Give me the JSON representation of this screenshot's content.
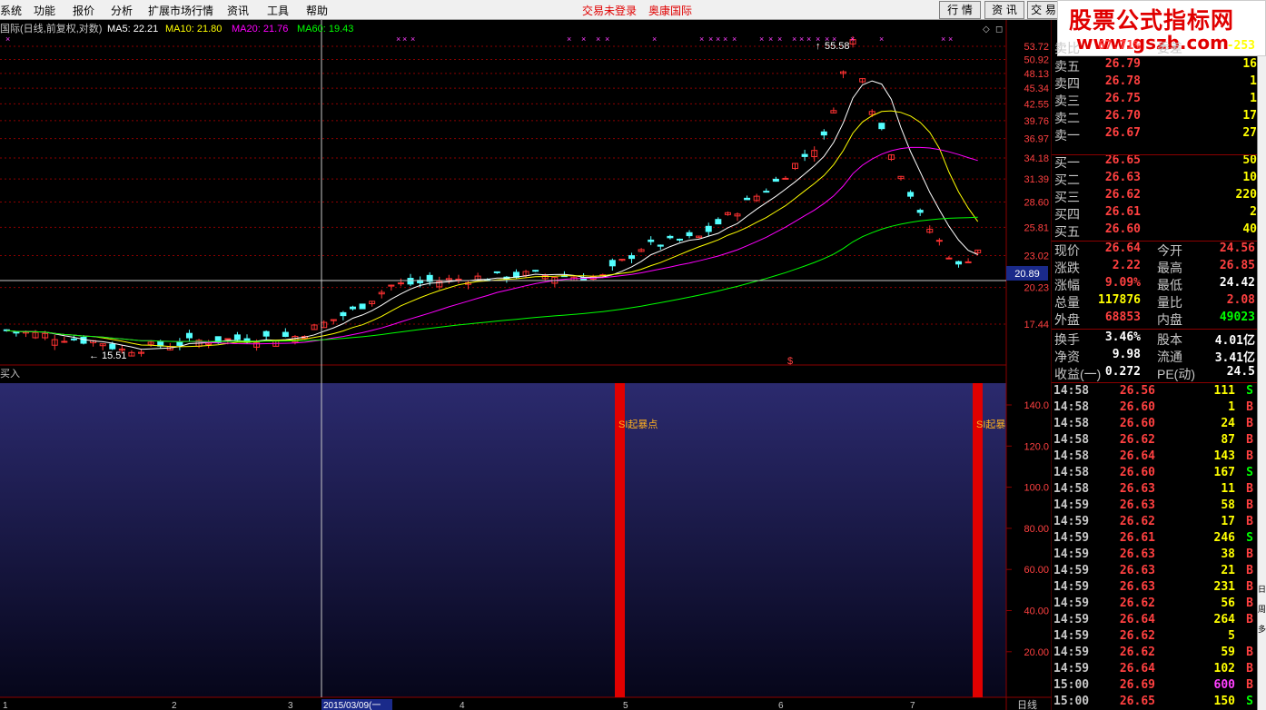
{
  "menu": {
    "items": [
      "系统",
      "功能",
      "报价",
      "分析",
      "扩展市场行情",
      "资讯",
      "工具",
      "帮助"
    ],
    "login_status": "交易未登录",
    "broker": "奥康国际",
    "btn_quote": "行 情",
    "btn_news": "资 讯",
    "btn_trade": "交 易"
  },
  "watermark": {
    "line1": "股票公式指标网",
    "line2": "www.gszb.com"
  },
  "colors": {
    "up": "#ff3232",
    "down": "#54ffff",
    "ma5": "#ffffff",
    "ma10": "#ffff00",
    "ma20": "#ff00ff",
    "ma60": "#00ff00",
    "grid": "#8b0000",
    "price": "#ff4040"
  },
  "chart": {
    "info": "国际(日线,前复权,对数)",
    "ma5": "MA5: 22.21",
    "ma10": "MA10: 21.80",
    "ma20": "MA20: 21.76",
    "ma60": "MA60: 19.43",
    "price_ticks": [
      "53.72",
      "50.92",
      "48.13",
      "45.34",
      "42.55",
      "39.76",
      "36.97",
      "34.18",
      "31.39",
      "28.60",
      "25.81",
      "23.02",
      "20.23",
      "17.44"
    ],
    "crosshair_value": "20.89",
    "high_label": "55.58",
    "low_label": "15.51",
    "dollar_mark": "$",
    "sub_title": "买入",
    "sub_ticks": [
      "140.0",
      "120.0",
      "100.0",
      "80.00",
      "60.00",
      "40.00",
      "20.00"
    ],
    "signal_labels": [
      "SI起暴点",
      "SI起暴"
    ],
    "date_labels": [
      "2015/03/09(一",
      "日线"
    ],
    "axis_numbers": [
      "1",
      "2",
      "3",
      "4",
      "5",
      "6",
      "7"
    ]
  },
  "quote": {
    "sell_title": "卖比",
    "sell_title_val": "67.71%",
    "sell_diff_title": "委差",
    "sell_diff_val": "-253",
    "asks": [
      {
        "label": "卖五",
        "price": "26.79",
        "vol": "16"
      },
      {
        "label": "卖四",
        "price": "26.78",
        "vol": "1"
      },
      {
        "label": "卖三",
        "price": "26.75",
        "vol": "1"
      },
      {
        "label": "卖二",
        "price": "26.70",
        "vol": "17"
      },
      {
        "label": "卖一",
        "price": "26.67",
        "vol": "27"
      }
    ],
    "bids": [
      {
        "label": "买一",
        "price": "26.65",
        "vol": "50"
      },
      {
        "label": "买二",
        "price": "26.63",
        "vol": "10"
      },
      {
        "label": "买三",
        "price": "26.62",
        "vol": "220"
      },
      {
        "label": "买四",
        "price": "26.61",
        "vol": "2"
      },
      {
        "label": "买五",
        "price": "26.60",
        "vol": "40"
      }
    ],
    "stats": [
      {
        "l1": "现价",
        "v1": "26.64",
        "l2": "今开",
        "v2": "24.56"
      },
      {
        "l1": "涨跌",
        "v1": "2.22",
        "l2": "最高",
        "v2": "26.85"
      },
      {
        "l1": "涨幅",
        "v1": "9.09%",
        "l2": "最低",
        "v2": "24.42"
      },
      {
        "l1": "总量",
        "v1": "117876",
        "l2": "量比",
        "v2": "2.08"
      },
      {
        "l1": "外盘",
        "v1": "68853",
        "l2": "内盘",
        "v2": "49023"
      },
      {
        "l1": "换手",
        "v1": "3.46%",
        "l2": "股本",
        "v2": "4.01亿"
      },
      {
        "l1": "净资",
        "v1": "9.98",
        "l2": "流通",
        "v2": "3.41亿"
      },
      {
        "l1": "收益(一)",
        "v1": "0.272",
        "l2": "PE(动)",
        "v2": "24.5"
      }
    ]
  },
  "ticks": [
    {
      "t": "14:58",
      "p": "26.56",
      "v": "111",
      "d": "S"
    },
    {
      "t": "14:58",
      "p": "26.60",
      "v": "1",
      "d": "B"
    },
    {
      "t": "14:58",
      "p": "26.60",
      "v": "24",
      "d": "B"
    },
    {
      "t": "14:58",
      "p": "26.62",
      "v": "87",
      "d": "B"
    },
    {
      "t": "14:58",
      "p": "26.64",
      "v": "143",
      "d": "B"
    },
    {
      "t": "14:58",
      "p": "26.60",
      "v": "167",
      "d": "S"
    },
    {
      "t": "14:58",
      "p": "26.63",
      "v": "11",
      "d": "B"
    },
    {
      "t": "14:59",
      "p": "26.63",
      "v": "58",
      "d": "B"
    },
    {
      "t": "14:59",
      "p": "26.62",
      "v": "17",
      "d": "B"
    },
    {
      "t": "14:59",
      "p": "26.61",
      "v": "246",
      "d": "S"
    },
    {
      "t": "14:59",
      "p": "26.63",
      "v": "38",
      "d": "B"
    },
    {
      "t": "14:59",
      "p": "26.63",
      "v": "21",
      "d": "B"
    },
    {
      "t": "14:59",
      "p": "26.63",
      "v": "231",
      "d": "B"
    },
    {
      "t": "14:59",
      "p": "26.62",
      "v": "56",
      "d": "B"
    },
    {
      "t": "14:59",
      "p": "26.64",
      "v": "264",
      "d": "B"
    },
    {
      "t": "14:59",
      "p": "26.62",
      "v": "5",
      "d": ""
    },
    {
      "t": "14:59",
      "p": "26.62",
      "v": "59",
      "d": "B"
    },
    {
      "t": "14:59",
      "p": "26.64",
      "v": "102",
      "d": "B"
    },
    {
      "t": "15:00",
      "p": "26.69",
      "v": "600",
      "d": "B"
    },
    {
      "t": "15:00",
      "p": "26.65",
      "v": "150",
      "d": "S"
    }
  ],
  "sidebar_glyphs": [
    "日",
    "周",
    "多"
  ]
}
